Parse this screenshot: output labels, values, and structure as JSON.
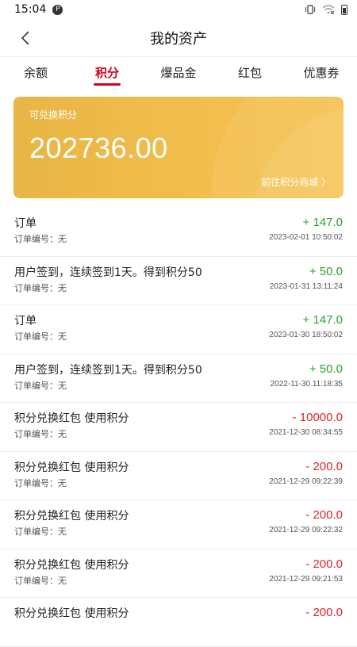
{
  "status_bar": {
    "time": "15:04",
    "app_badge": "P"
  },
  "header": {
    "title": "我的资产",
    "back_icon": "chevron-left-icon"
  },
  "tabs": [
    {
      "label": "余额",
      "active": false
    },
    {
      "label": "积分",
      "active": true
    },
    {
      "label": "爆品金",
      "active": false
    },
    {
      "label": "红包",
      "active": false
    },
    {
      "label": "优惠券",
      "active": false
    }
  ],
  "card": {
    "label": "可兑换积分",
    "amount": "202736.00",
    "link": "前往积分商城 〉"
  },
  "records": [
    {
      "title": "订单",
      "sub": "订单编号：无",
      "amount": "+ 147.0",
      "time": "2023-02-01 10:50:02",
      "type": "plus"
    },
    {
      "title": "用户签到，连续签到1天。得到积分50",
      "sub": "订单编号：无",
      "amount": "+ 50.0",
      "time": "2023-01-31 13:11:24",
      "type": "plus"
    },
    {
      "title": "订单",
      "sub": "订单编号：无",
      "amount": "+ 147.0",
      "time": "2023-01-30 18:50:02",
      "type": "plus"
    },
    {
      "title": "用户签到，连续签到1天。得到积分50",
      "sub": "订单编号：无",
      "amount": "+ 50.0",
      "time": "2022-11-30 11:18:35",
      "type": "plus"
    },
    {
      "title": "积分兑换红包 使用积分",
      "sub": "订单编号：无",
      "amount": "- 10000.0",
      "time": "2021-12-30 08:34:55",
      "type": "minus"
    },
    {
      "title": "积分兑换红包 使用积分",
      "sub": "订单编号：无",
      "amount": "- 200.0",
      "time": "2021-12-29 09:22:39",
      "type": "minus"
    },
    {
      "title": "积分兑换红包 使用积分",
      "sub": "订单编号：无",
      "amount": "- 200.0",
      "time": "2021-12-29 09:22:32",
      "type": "minus"
    },
    {
      "title": "积分兑换红包 使用积分",
      "sub": "订单编号：无",
      "amount": "- 200.0",
      "time": "2021-12-29 09:21:53",
      "type": "minus"
    },
    {
      "title": "积分兑换红包 使用积分",
      "sub": "",
      "amount": "- 200.0",
      "time": "",
      "type": "minus"
    }
  ],
  "colors": {
    "accent": "#d0021b",
    "plus": "#2aa52a",
    "minus": "#e02525",
    "card": "#f2bd4c"
  }
}
